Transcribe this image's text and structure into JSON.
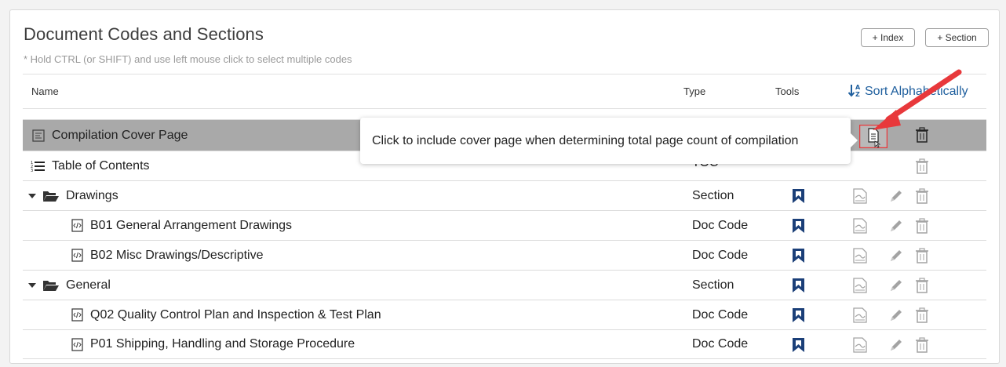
{
  "panel": {
    "title": "Document Codes and Sections",
    "hint": "* Hold CTRL (or SHIFT) and use left mouse click to select multiple codes",
    "index_button": "+ Index",
    "section_button": "+ Section"
  },
  "table": {
    "headers": {
      "name": "Name",
      "type": "Type",
      "tools": "Tools"
    },
    "sort_label": "Sort Alphabetically"
  },
  "tooltip": {
    "text": "Click to include cover page when determining total page count of compilation"
  },
  "rows": [
    {
      "name": "Compilation Cover Page",
      "type": ""
    },
    {
      "name": "Table of Contents",
      "type": "TOC"
    },
    {
      "name": "Drawings",
      "type": "Section"
    },
    {
      "name": "B01 General Arrangement Drawings",
      "type": "Doc Code"
    },
    {
      "name": "B02 Misc Drawings/Descriptive",
      "type": "Doc Code"
    },
    {
      "name": "General",
      "type": "Section"
    },
    {
      "name": "Q02 Quality Control Plan and Inspection & Test Plan",
      "type": "Doc Code"
    },
    {
      "name": "P01 Shipping, Handling and Storage Procedure",
      "type": "Doc Code"
    }
  ],
  "colors": {
    "accent_blue": "#1f5f9e",
    "bookmark_navy": "#1b3f78",
    "highlight_row": "#a9a9a9",
    "annotation_red": "#e8383b",
    "tool_gray": "#a3a3a3"
  }
}
